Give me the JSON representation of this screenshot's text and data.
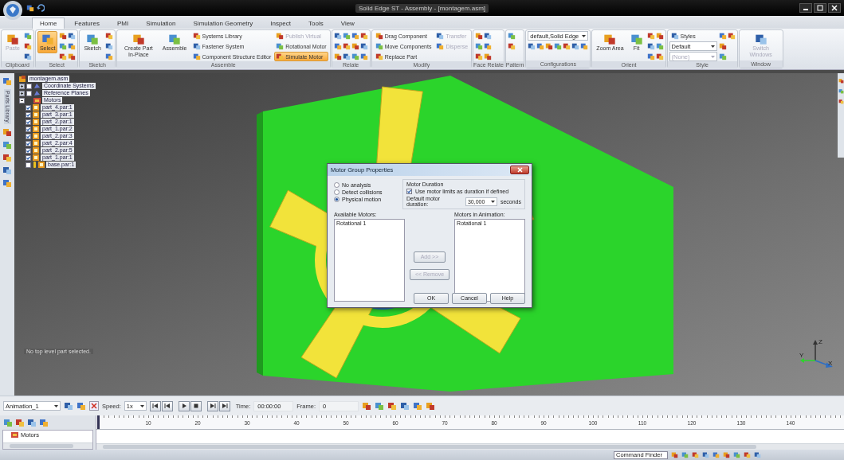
{
  "window": {
    "title": "Solid Edge ST - Assembly - [montagem.asm]"
  },
  "tabs": [
    {
      "label": "Home",
      "selected": true
    },
    {
      "label": "Features",
      "selected": false
    },
    {
      "label": "PMI",
      "selected": false
    },
    {
      "label": "Simulation",
      "selected": false
    },
    {
      "label": "Simulation Geometry",
      "selected": false
    },
    {
      "label": "Inspect",
      "selected": false
    },
    {
      "label": "Tools",
      "selected": false
    },
    {
      "label": "View",
      "selected": false
    }
  ],
  "ribbon": [
    {
      "label": "Clipboard",
      "commands": [
        {
          "kind": "large",
          "label": "Paste",
          "disabled": true,
          "active": false
        }
      ]
    },
    {
      "label": "Select",
      "commands": [
        {
          "kind": "large",
          "label": "Select",
          "disabled": false,
          "active": true
        }
      ]
    },
    {
      "label": "Sketch",
      "commands": [
        {
          "kind": "large",
          "label": "Sketch",
          "disabled": false,
          "active": false
        }
      ]
    },
    {
      "label": "Assemble",
      "commands": [
        {
          "kind": "large",
          "label": "Create Part In-Place",
          "disabled": false,
          "active": false
        },
        {
          "kind": "large",
          "label": "Assemble",
          "disabled": false,
          "active": false
        },
        {
          "kind": "small",
          "label": "Systems Library",
          "disabled": false,
          "active": false
        },
        {
          "kind": "small",
          "label": "Fastener System",
          "disabled": false,
          "active": false
        },
        {
          "kind": "small",
          "label": "Component Structure Editor",
          "disabled": false,
          "active": false
        },
        {
          "kind": "small",
          "label": "Publish Virtual",
          "disabled": true,
          "active": false
        },
        {
          "kind": "small",
          "label": "Rotational Motor",
          "disabled": false,
          "active": false
        },
        {
          "kind": "small",
          "label": "Simulate Motor",
          "disabled": false,
          "active": true
        }
      ]
    },
    {
      "label": "Relate"
    },
    {
      "label": "Modify",
      "commands": [
        {
          "kind": "small",
          "label": "Drag Component",
          "disabled": false,
          "active": false
        },
        {
          "kind": "small",
          "label": "Move Components",
          "disabled": false,
          "active": false
        },
        {
          "kind": "small",
          "label": "Replace Part",
          "disabled": false,
          "active": false
        },
        {
          "kind": "small",
          "label": "Transfer",
          "disabled": true,
          "active": false
        },
        {
          "kind": "small",
          "label": "Disperse",
          "disabled": true,
          "active": false
        }
      ]
    },
    {
      "label": "Face Relate"
    },
    {
      "label": "Pattern"
    },
    {
      "label": "Configurations",
      "commands": [
        {
          "kind": "dropdown",
          "label": "default,Solid Edge",
          "disabled": false
        }
      ]
    },
    {
      "label": "Orient",
      "commands": [
        {
          "kind": "large",
          "label": "Zoom Area",
          "disabled": false,
          "active": false
        },
        {
          "kind": "large",
          "label": "Fit",
          "disabled": false,
          "active": false
        }
      ]
    },
    {
      "label": "Style",
      "commands": [
        {
          "kind": "small",
          "label": "Styles",
          "disabled": false,
          "active": false
        },
        {
          "kind": "dropdown",
          "label": "Default",
          "disabled": false
        },
        {
          "kind": "dropdown",
          "label": "(None)",
          "disabled": true
        }
      ]
    },
    {
      "label": "Window",
      "commands": [
        {
          "kind": "large",
          "label": "Switch Windows",
          "disabled": true,
          "active": false
        }
      ]
    }
  ],
  "side_tab": "Parts Library",
  "tree": {
    "label": "montagem.asm",
    "children": [
      {
        "kind": "collection",
        "label": "Coordinate Systems",
        "expanded": false,
        "checked": false
      },
      {
        "kind": "collection",
        "label": "Reference Planes",
        "expanded": false,
        "checked": false
      },
      {
        "kind": "folder",
        "label": "Motors",
        "expanded": true
      },
      {
        "kind": "part",
        "label": "part_4.par:1",
        "checked": true
      },
      {
        "kind": "part",
        "label": "part_3.par:1",
        "checked": true
      },
      {
        "kind": "part",
        "label": "part_2.par:1",
        "checked": true
      },
      {
        "kind": "part",
        "label": "part_1.par:2",
        "checked": true
      },
      {
        "kind": "part",
        "label": "part_2.par:3",
        "checked": true
      },
      {
        "kind": "part",
        "label": "part_2.par:4",
        "checked": true
      },
      {
        "kind": "part",
        "label": "part_2.par:5",
        "checked": true
      },
      {
        "kind": "part",
        "label": "part_1.par:1",
        "checked": true
      },
      {
        "kind": "base",
        "label": "base.par:1",
        "checked": false
      }
    ]
  },
  "viewport_message": "No top level part selected.",
  "triad": [
    "Z",
    "Y",
    "X"
  ],
  "dialog": {
    "title": "Motor Group Properties",
    "analysis": [
      {
        "label": "No analysis",
        "selected": false
      },
      {
        "label": "Detect collisions",
        "selected": false
      },
      {
        "label": "Physical motion",
        "selected": true
      }
    ],
    "duration_group": "Motor Duration",
    "use_limits": {
      "label": "Use motor limits as duration if defined",
      "checked": true
    },
    "duration_label": "Default motor duration:",
    "duration_value": "30,000",
    "duration_unit": "seconds",
    "available_label": "Available Motors:",
    "available": [
      "Rotational 1"
    ],
    "animation_label": "Motors in Animation:",
    "in_animation": [
      "Rotational 1"
    ],
    "move_buttons": [
      {
        "label": "Add >>",
        "disabled": true
      },
      {
        "label": "<< Remove",
        "disabled": true
      }
    ],
    "buttons": [
      "OK",
      "Cancel",
      "Help"
    ]
  },
  "animation": {
    "name": "Animation_1",
    "speed_label": "Speed:",
    "speed": "1x",
    "time_label": "Time:",
    "time": "00:00:00",
    "frame_label": "Frame:",
    "frame": "0",
    "ticks": [
      "10",
      "20",
      "30",
      "40",
      "50",
      "60",
      "70",
      "80",
      "90",
      "100",
      "110",
      "120",
      "130",
      "140"
    ],
    "tracks": [
      "Motors"
    ]
  },
  "status_bar": {
    "placeholder": "Command Finder"
  }
}
